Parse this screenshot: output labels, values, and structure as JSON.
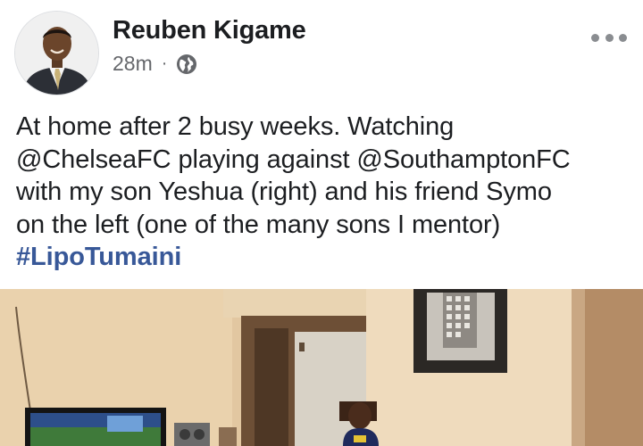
{
  "post": {
    "author": "Reuben Kigame",
    "timestamp": "28m",
    "separator": "·",
    "audience_icon": "globe-icon",
    "text_lines": [
      "At home after 2 busy weeks. Watching",
      "@ChelseaFC playing against @SouthamptonFC",
      "with my son Yeshua (right) and his friend Symo",
      "on the left (one of the many sons I mentor)"
    ],
    "hashtag": "#LipoTumaini"
  },
  "colors": {
    "text": "#1c1e21",
    "muted": "#65676b",
    "hashtag": "#385898",
    "icon": "#8a8d91"
  },
  "icons": [
    "more-options-icon",
    "globe-icon"
  ]
}
